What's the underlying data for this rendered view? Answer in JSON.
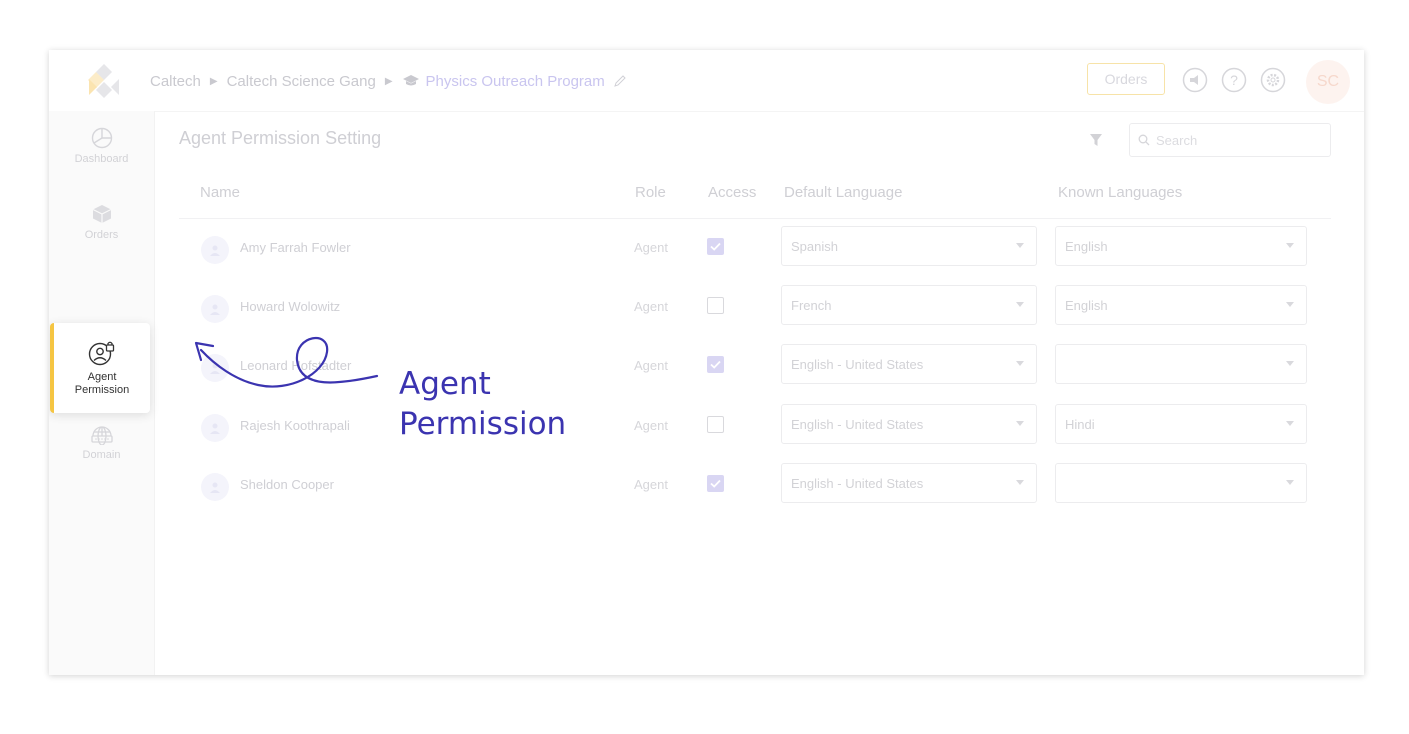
{
  "breadcrumb": {
    "items": [
      "Caltech",
      "Caltech Science Gang",
      "Physics Outreach Program"
    ]
  },
  "header": {
    "orders_label": "Orders",
    "user_initials": "SC"
  },
  "sidebar": {
    "items": [
      {
        "label": "Dashboard",
        "icon": "pie-chart-icon"
      },
      {
        "label": "Orders",
        "icon": "box-icon"
      },
      {
        "label": "Agent Permission",
        "label_line1": "Agent",
        "label_line2": "Permission",
        "icon": "user-lock-icon",
        "active": true
      },
      {
        "label": "Domain",
        "icon": "globe-icon"
      }
    ]
  },
  "main": {
    "title": "Agent Permission Setting",
    "search_placeholder": "Search",
    "columns": [
      "Name",
      "Role",
      "Access",
      "Default Language",
      "Known Languages"
    ],
    "rows": [
      {
        "name": "Amy Farrah Fowler",
        "role": "Agent",
        "access": true,
        "default_language": "Spanish",
        "known_languages": "English"
      },
      {
        "name": "Howard Wolowitz",
        "role": "Agent",
        "access": false,
        "default_language": "French",
        "known_languages": "English"
      },
      {
        "name": "Leonard Hofstadter",
        "role": "Agent",
        "access": true,
        "default_language": "English - United States",
        "known_languages": ""
      },
      {
        "name": "Rajesh Koothrapali",
        "role": "Agent",
        "access": false,
        "default_language": "English - United States",
        "known_languages": "Hindi"
      },
      {
        "name": "Sheldon Cooper",
        "role": "Agent",
        "access": true,
        "default_language": "English - United States",
        "known_languages": ""
      }
    ]
  },
  "annotation": {
    "line1": "Agent",
    "line2": "Permission"
  },
  "colors": {
    "accent": "#f5c542",
    "annotation": "#3b34b0",
    "checkbox_on": "#d9d6f3"
  }
}
